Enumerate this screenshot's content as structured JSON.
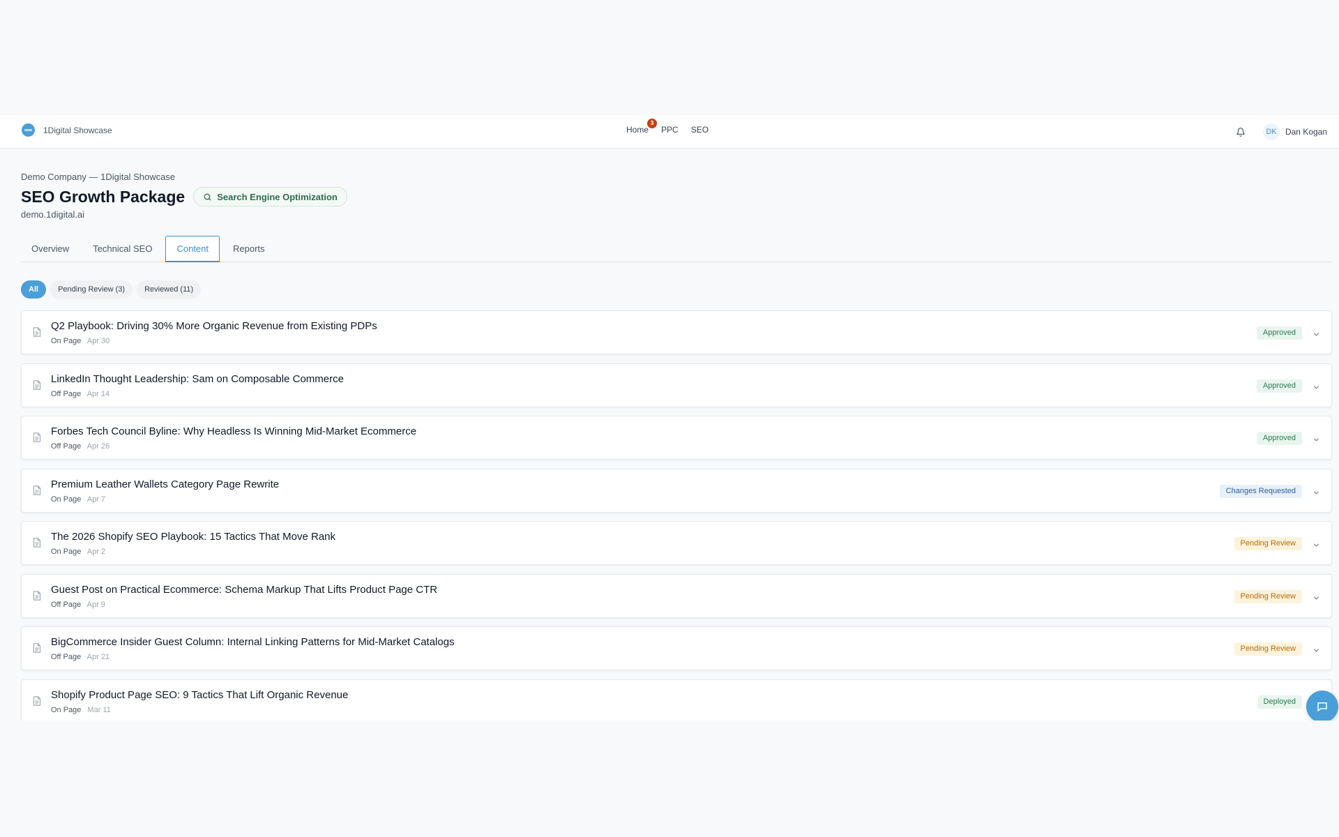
{
  "brand": {
    "name": "1Digital Showcase"
  },
  "nav": {
    "items": [
      {
        "label": "Home",
        "badge": "3"
      },
      {
        "label": "PPC"
      },
      {
        "label": "SEO"
      }
    ]
  },
  "user": {
    "initials": "DK",
    "name": "Dan Kogan"
  },
  "header": {
    "breadcrumb": "Demo Company — 1Digital Showcase",
    "title": "SEO Growth Package",
    "service_pill": "Search Engine Optimization",
    "domain": "demo.1digital.ai"
  },
  "tabs": [
    "Overview",
    "Technical SEO",
    "Content",
    "Reports"
  ],
  "active_tab": "Content",
  "filters": [
    "All",
    "Pending Review (3)",
    "Reviewed (11)"
  ],
  "active_filter": "All",
  "content_items": [
    {
      "title": "Q2 Playbook: Driving 30% More Organic Revenue from Existing PDPs",
      "category": "On Page",
      "date": "Apr 30",
      "status": "Approved",
      "status_key": "approved"
    },
    {
      "title": "LinkedIn Thought Leadership: Sam on Composable Commerce",
      "category": "Off Page",
      "date": "Apr 14",
      "status": "Approved",
      "status_key": "approved"
    },
    {
      "title": "Forbes Tech Council Byline: Why Headless Is Winning Mid-Market Ecommerce",
      "category": "Off Page",
      "date": "Apr 26",
      "status": "Approved",
      "status_key": "approved"
    },
    {
      "title": "Premium Leather Wallets Category Page Rewrite",
      "category": "On Page",
      "date": "Apr 7",
      "status": "Changes Requested",
      "status_key": "changes"
    },
    {
      "title": "The 2026 Shopify SEO Playbook: 15 Tactics That Move Rank",
      "category": "On Page",
      "date": "Apr 2",
      "status": "Pending Review",
      "status_key": "pending"
    },
    {
      "title": "Guest Post on Practical Ecommerce: Schema Markup That Lifts Product Page CTR",
      "category": "Off Page",
      "date": "Apr 9",
      "status": "Pending Review",
      "status_key": "pending"
    },
    {
      "title": "BigCommerce Insider Guest Column: Internal Linking Patterns for Mid-Market Catalogs",
      "category": "Off Page",
      "date": "Apr 21",
      "status": "Pending Review",
      "status_key": "pending"
    },
    {
      "title": "Shopify Product Page SEO: 9 Tactics That Lift Organic Revenue",
      "category": "On Page",
      "date": "Mar 11",
      "status": "Deployed",
      "status_key": "deployed"
    }
  ],
  "icons": {
    "bell": "bell-icon",
    "search": "search-icon",
    "document": "document-icon",
    "chevron": "chevron-down-icon",
    "chat": "chat-icon"
  },
  "colors": {
    "accent": "#4a9fd8",
    "badge": "#c2410c",
    "approved": "#2f7a55",
    "pending": "#b46b0c",
    "changes": "#2f5f9e"
  }
}
